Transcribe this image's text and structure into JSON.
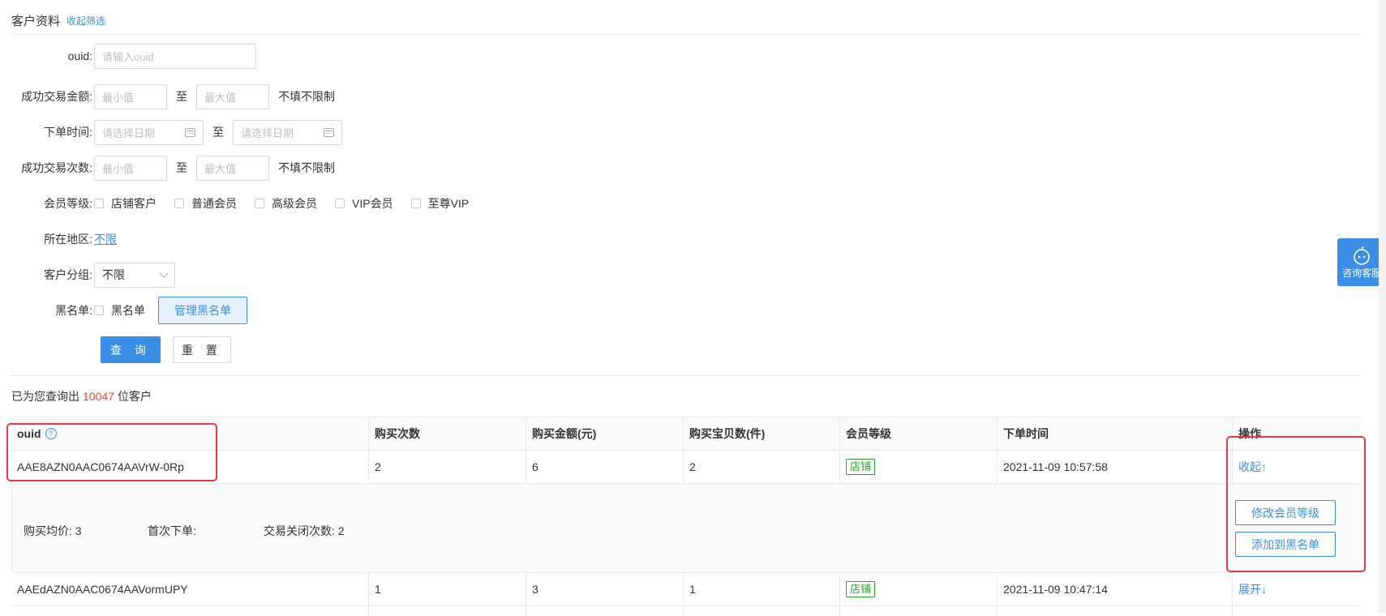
{
  "header": {
    "title": "客户资料",
    "collapse_link": "收起筛选"
  },
  "form": {
    "ouid": {
      "label": "ouid:",
      "placeholder": "请输入ouid"
    },
    "amount": {
      "label": "成功交易金额:",
      "min_placeholder": "最小值",
      "sep": "至",
      "max_placeholder": "最大值",
      "hint": "不填不限制"
    },
    "order_time": {
      "label": "下单时间:",
      "start_placeholder": "请选择日期",
      "sep": "至",
      "end_placeholder": "请选择日期"
    },
    "count": {
      "label": "成功交易次数:",
      "min_placeholder": "最小值",
      "sep": "至",
      "max_placeholder": "最大值",
      "hint": "不填不限制"
    },
    "member_level": {
      "label": "会员等级:",
      "options": [
        "店铺客户",
        "普通会员",
        "高级会员",
        "VIP会员",
        "至尊VIP"
      ]
    },
    "region": {
      "label": "所在地区:",
      "value": "不限"
    },
    "group": {
      "label": "客户分组:",
      "value": "不限"
    },
    "blacklist": {
      "label": "黑名单:",
      "checkbox_label": "黑名单",
      "manage_button": "管理黑名单"
    },
    "query_button": "查 询",
    "reset_button": "重 置"
  },
  "result": {
    "prefix": "已为您查询出",
    "count": "10047",
    "suffix": "位客户"
  },
  "table": {
    "headers": [
      "ouid",
      "购买次数",
      "购买金额(元)",
      "购买宝贝数(件)",
      "会员等级",
      "下单时间",
      "操作"
    ],
    "help_icon": "?",
    "rows": [
      {
        "ouid": "AAE8AZN0AAC0674AAVrW-0Rp",
        "times": "2",
        "amount": "6",
        "items": "2",
        "level": "店铺",
        "time": "2021-11-09 10:57:58",
        "op": "收起↑"
      },
      {
        "ouid": "AAEdAZN0AAC0674AAVormUPY",
        "times": "1",
        "amount": "3",
        "items": "1",
        "level": "店铺",
        "time": "2021-11-09 10:47:14",
        "op": "展开↓"
      }
    ],
    "expand": {
      "avg_price": "购买均价: 3",
      "first_order": "首次下单:",
      "closed_count": "交易关闭次数: 2",
      "modify_button": "修改会员等级",
      "blacklist_button": "添加到黑名单"
    }
  },
  "consult": {
    "label": "咨询客服"
  },
  "colors": {
    "accent": "#3a8ee6",
    "highlight": "#e63946",
    "badge": "#2ea12e",
    "count": "#e8412e"
  }
}
